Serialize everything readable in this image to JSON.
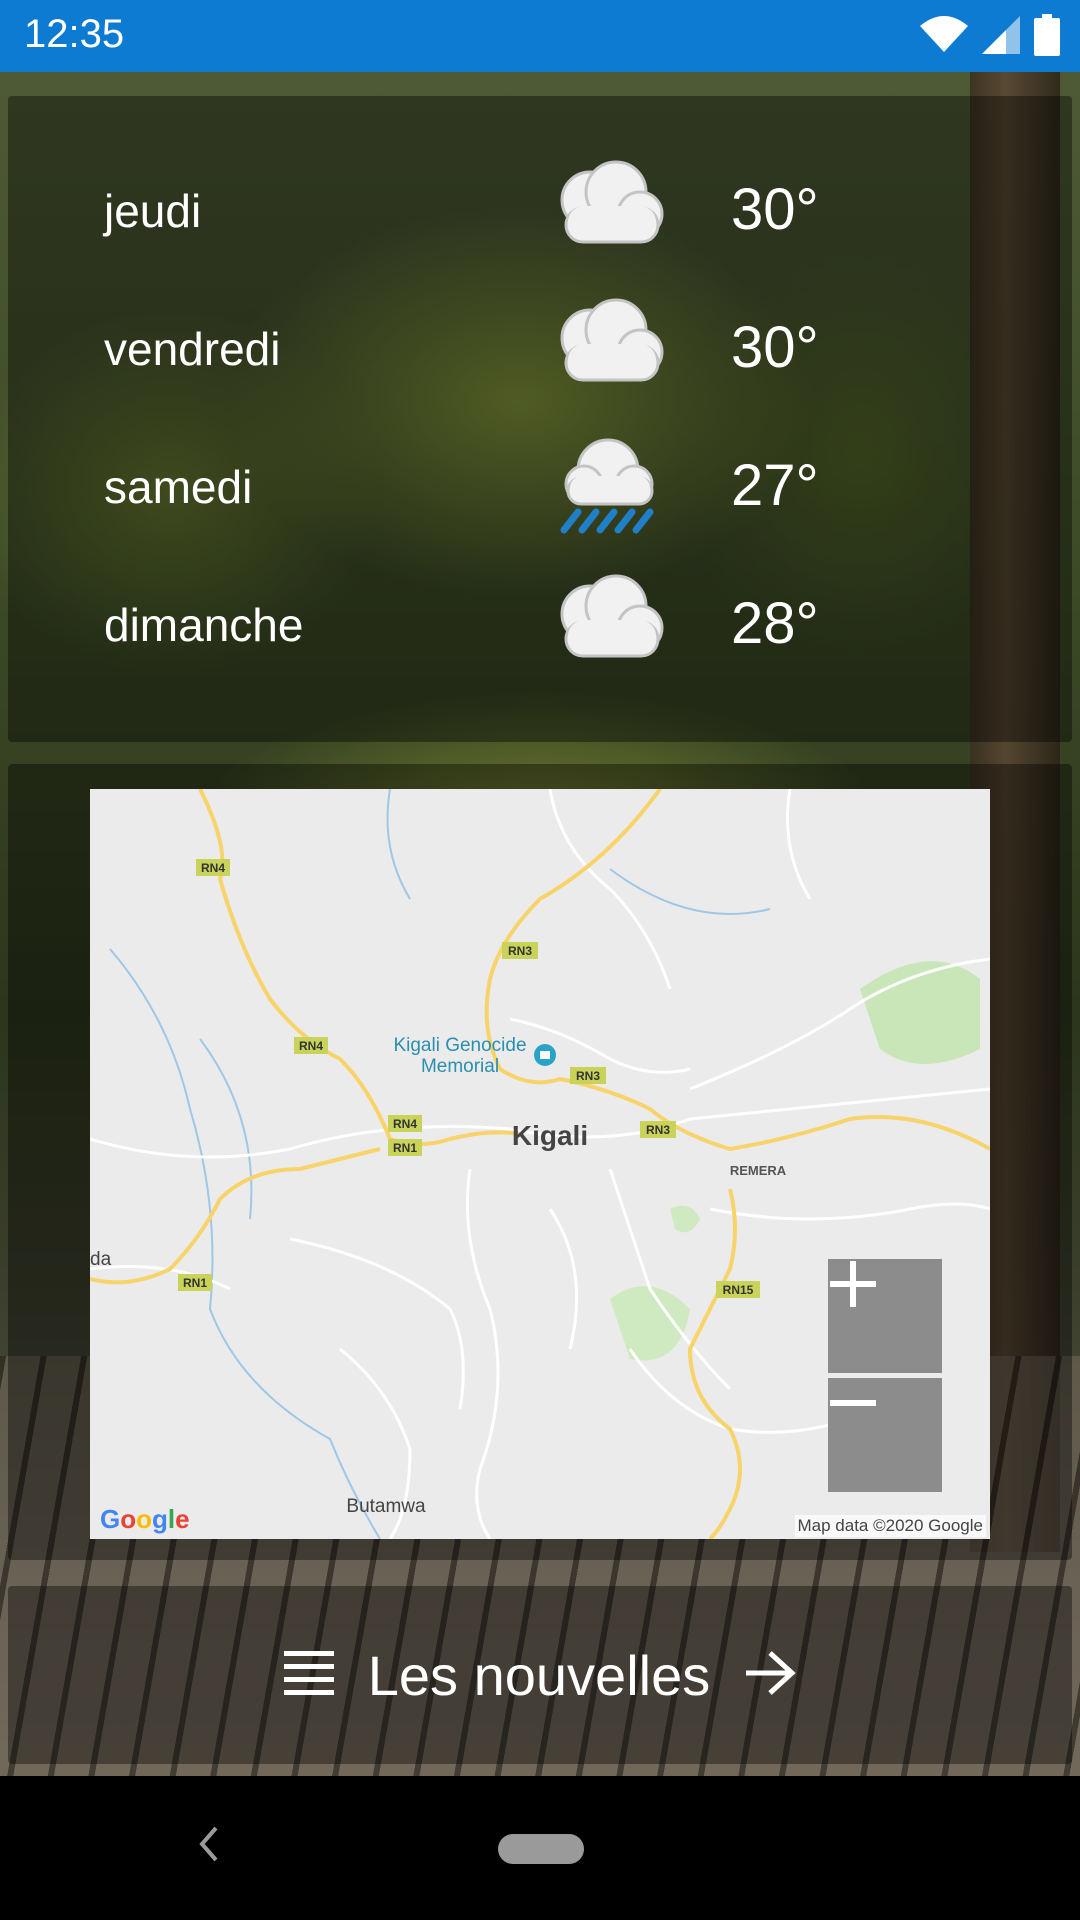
{
  "status_bar": {
    "time": "12:35",
    "wifi_icon": "wifi-icon",
    "signal_icon": "signal-icon",
    "battery_icon": "battery-icon"
  },
  "forecast": [
    {
      "day": "jeudi",
      "icon": "cloud-icon",
      "temp": "30°"
    },
    {
      "day": "vendredi",
      "icon": "cloud-icon",
      "temp": "30°"
    },
    {
      "day": "samedi",
      "icon": "rain-cloud-icon",
      "temp": "27°"
    },
    {
      "day": "dimanche",
      "icon": "cloud-icon",
      "temp": "28°"
    }
  ],
  "map": {
    "city_label": "Kigali",
    "poi_label_1": "Kigali Genocide",
    "poi_label_2": "Memorial",
    "district_label": "REMERA",
    "place_label_1": "Butamwa",
    "place_label_2": "da",
    "road_labels": [
      "RN4",
      "RN3",
      "RN4",
      "RN3",
      "RN3",
      "RN4",
      "RN1",
      "RN1",
      "RN15"
    ],
    "zoom_in": "+",
    "zoom_out": "−",
    "attribution": "Map data ©2020 Google",
    "logo": "Google"
  },
  "news": {
    "label": "Les nouvelles",
    "list_icon": "list-icon",
    "arrow_icon": "arrow-right-icon"
  },
  "navigation": {
    "back_icon": "back-icon",
    "home_icon": "home-pill-icon"
  },
  "colors": {
    "status_bar": "#0c7bd1",
    "road": "#f7d36a",
    "road_label_bg": "#c9d35a",
    "water": "#8fc2e8",
    "park": "#c8e6b8"
  }
}
